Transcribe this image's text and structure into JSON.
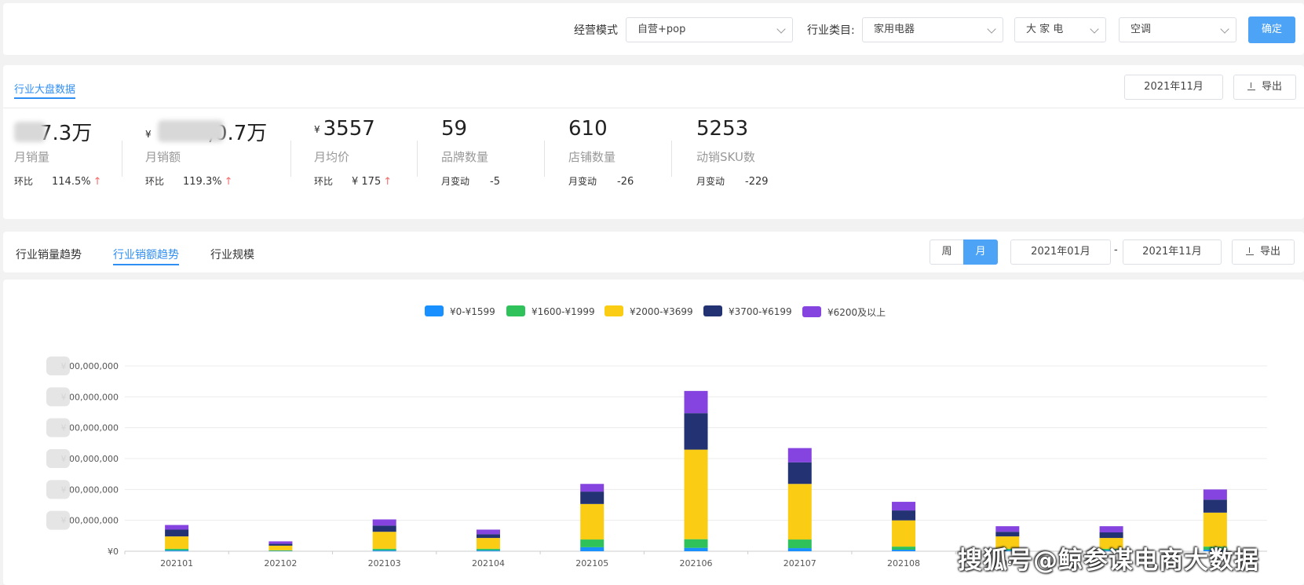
{
  "filters": {
    "mode_label": "经营模式",
    "mode_value": "自营+pop",
    "category_label": "行业类目:",
    "category_value": "家用电器",
    "subcategory_value": "大 家 电",
    "leaf_value": "空调",
    "confirm_label": "确定"
  },
  "overview": {
    "tab_label": "行业大盘数据",
    "month_value": "2021年11月",
    "export_label": "导出",
    "currency_symbol": "¥",
    "kpis": [
      {
        "value": "7.3万",
        "name": "月销量",
        "sub_key": "环比",
        "sub_value": "114.5%",
        "arrow": "↑"
      },
      {
        "value": ",0.7万",
        "name": "月销额",
        "sub_key": "环比",
        "sub_value": "119.3%",
        "arrow": "↑"
      },
      {
        "value": "3557",
        "name": "月均价",
        "sub_key": "环比",
        "sub_value": "¥ 175",
        "arrow": "↑"
      },
      {
        "value": "59",
        "name": "品牌数量",
        "sub_key": "月变动",
        "sub_value": "-5",
        "arrow": ""
      },
      {
        "value": "610",
        "name": "店铺数量",
        "sub_key": "月变动",
        "sub_value": "-26",
        "arrow": ""
      },
      {
        "value": "5253",
        "name": "动销SKU数",
        "sub_key": "月变动",
        "sub_value": "-229",
        "arrow": ""
      }
    ]
  },
  "trend": {
    "tabs": [
      "行业销量趋势",
      "行业销额趋势",
      "行业规模"
    ],
    "active_tab": 1,
    "week_label": "周",
    "month_label": "月",
    "start_month": "2021年01月",
    "range_sep": "-",
    "end_month": "2021年11月",
    "export_label": "导出"
  },
  "chart_data": {
    "type": "bar",
    "stacked": true,
    "categories": [
      "202101",
      "202102",
      "202103",
      "202104",
      "202105",
      "202106",
      "202107",
      "202108",
      "202109",
      "202110",
      "202111"
    ],
    "tick_labels": [
      "202101",
      "202102",
      "202103",
      "202104",
      "202105",
      "202106",
      "202107",
      "202108",
      "09",
      "",
      "21"
    ],
    "series": [
      {
        "name": "¥0-¥1599",
        "color": "#1890ff",
        "values": [
          0.03,
          0.01,
          0.03,
          0.03,
          0.13,
          0.11,
          0.1,
          0.05,
          0.03,
          0.03,
          0.05
        ]
      },
      {
        "name": "¥1600-¥1999",
        "color": "#2fc25b",
        "values": [
          0.05,
          0.02,
          0.05,
          0.05,
          0.25,
          0.28,
          0.28,
          0.1,
          0.05,
          0.05,
          0.1
        ]
      },
      {
        "name": "¥2000-¥3699",
        "color": "#facc14",
        "values": [
          0.4,
          0.15,
          0.55,
          0.35,
          1.15,
          2.9,
          1.8,
          0.85,
          0.4,
          0.35,
          1.1
        ]
      },
      {
        "name": "¥3700-¥6199",
        "color": "#223273",
        "values": [
          0.22,
          0.06,
          0.2,
          0.12,
          0.4,
          1.18,
          0.7,
          0.32,
          0.15,
          0.18,
          0.42
        ]
      },
      {
        "name": "¥6200及以上",
        "color": "#8543e0",
        "values": [
          0.15,
          0.08,
          0.2,
          0.15,
          0.25,
          0.72,
          0.46,
          0.28,
          0.18,
          0.2,
          0.33
        ]
      }
    ],
    "ylim": [
      0,
      6
    ],
    "y_ticks": [
      0,
      1,
      2,
      3,
      4,
      5,
      6
    ],
    "y_tick_labels": [
      "¥0",
      "¥ 00,000,000",
      "¥ 00,000,000",
      "¥ 00,000,000",
      "¥ 00,000,000",
      "¥ 00,000,000",
      "¥ 00,000,000"
    ],
    "grid": true,
    "legend_position": "top-center"
  },
  "watermark": "搜狐号@鲸参谋电商大数据"
}
